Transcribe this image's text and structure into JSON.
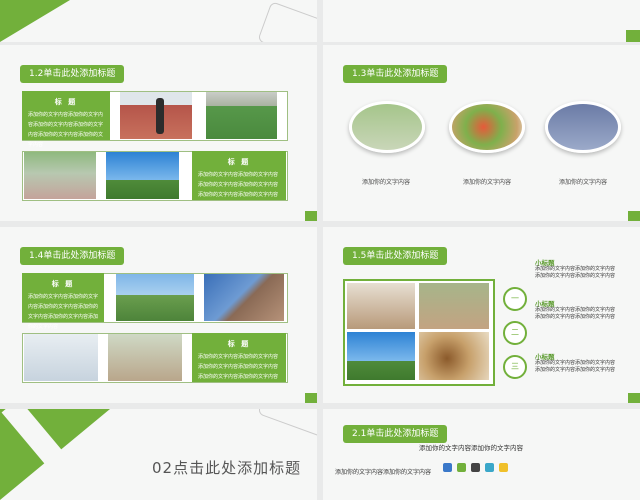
{
  "colors": {
    "accent": "#72b03b",
    "background": "#e9eaea",
    "slide": "#f6f7f6"
  },
  "slides": [
    {
      "tag": "1.2单击此处添加标题",
      "box1": {
        "title": "标  题",
        "body": "添加你的文字内容添加你的文字内容添加你的文字内容添加你的文字内容添加你的文字内容添加你的文字内容"
      },
      "box2": {
        "title": "标  题",
        "body": "添加你的文字内容添加你的文字内容添加你的文字内容添加你的文字内容添加你的文字内容添加你的文字内容"
      }
    },
    {
      "tag": "1.3单击此处添加标题",
      "captions": [
        "添加你的文字内容",
        "添加你的文字内容",
        "添加你的文字内容"
      ]
    },
    {
      "tag": "1.4单击此处添加标题",
      "box1": {
        "title": "标  题",
        "body": "添加你的文字内容添加你的文字内容添加你的文字内容添加你的文字内容添加你的文字内容添加你的文字内容"
      },
      "box2": {
        "title": "标  题",
        "body": "添加你的文字内容添加你的文字内容添加你的文字内容添加你的文字内容添加你的文字内容添加你的文字内容"
      }
    },
    {
      "tag": "1.5单击此处添加标题",
      "items": [
        {
          "num": "一",
          "title": "小标题",
          "body": "添加你的文字内容添加你的文字内容添加你的文字内容添加你的文字内容"
        },
        {
          "num": "二",
          "title": "小标题",
          "body": "添加你的文字内容添加你的文字内容添加你的文字内容添加你的文字内容"
        },
        {
          "num": "三",
          "title": "小标题",
          "body": "添加你的文字内容添加你的文字内容添加你的文字内容添加你的文字内容"
        }
      ]
    },
    {
      "title": "02点击此处添加标题"
    },
    {
      "tag": "2.1单击此处添加标题",
      "line1": "添加你的文字内容添加你的文字内容",
      "line2": "添加你的文字内容添加你的文字内容"
    }
  ]
}
